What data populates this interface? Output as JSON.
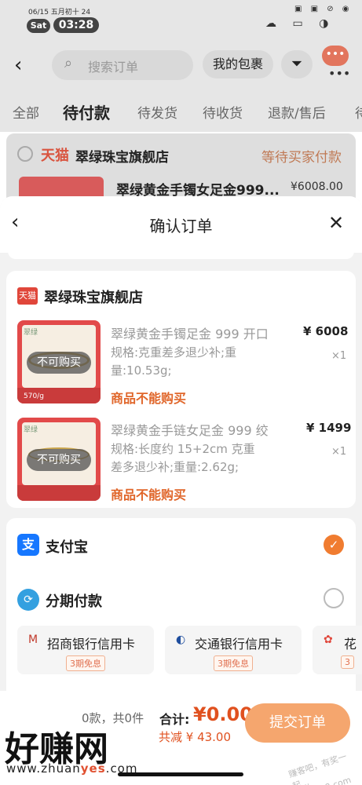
{
  "status_bar": {
    "date": "06/15 五月初十 24",
    "day": "Sat",
    "time": "03:28",
    "right_icons": "▣ ▣ ⊘ ◉"
  },
  "header": {
    "search_placeholder": "搜索订单",
    "my_bag": "我的包裹"
  },
  "tabs": [
    "全部",
    "待付款",
    "待发货",
    "待收货",
    "退款/售后",
    "待"
  ],
  "active_tab": "待付款",
  "background_order": {
    "platform": "天猫",
    "shop": "翠绿珠宝旗舰店",
    "status": "等待买家付款",
    "product": "翠绿黄金手镯女足金999...",
    "price": "¥6008.00"
  },
  "sheet": {
    "title": "确认订单",
    "platform_badge": "天猫",
    "shop": "翠绿珠宝旗舰店",
    "products": [
      {
        "name": "翠绿黄金手镯足金 999 开口",
        "spec_line1": "规格:克重差多退少补;重",
        "spec_line2": "量:10.53g;",
        "price": "¥ 6008",
        "qty": "×1",
        "warning": "商品不能购买",
        "overlay": "不可购买",
        "image_brand": "翠绿",
        "image_price_tag": "570/g"
      },
      {
        "name": "翠绿黄金手链女足金 999 绞",
        "spec_line1": "规格:长度约 15+2cm 克重",
        "spec_line2": "差多退少补;重量:2.62g;",
        "price": "¥ 1499",
        "qty": "×1",
        "warning": "商品不能购买",
        "overlay": "不可购买",
        "image_brand": "翠绿",
        "image_price_tag": ""
      }
    ],
    "payment": {
      "alipay_label": "支付宝",
      "installment_label": "分期付款",
      "banks": [
        {
          "name": "招商银行信用卡",
          "badge": "3期免息",
          "icon": "M"
        },
        {
          "name": "交通银行信用卡",
          "badge": "3期免息",
          "icon": "◐"
        },
        {
          "name": "花",
          "badge": "3",
          "icon": "✿"
        }
      ]
    },
    "footer": {
      "count": "0款，共0件",
      "total_label": "合计:",
      "total_value": "¥0.00",
      "saved": "共减 ¥ 43.00",
      "submit": "提交订单"
    }
  },
  "watermark": {
    "big": "好赚网",
    "url_prefix": "www.zhuan",
    "url_highlight": "yes",
    "url_suffix": ".com",
    "right": "赚客吧，有奖一起... zuanke8.com"
  }
}
